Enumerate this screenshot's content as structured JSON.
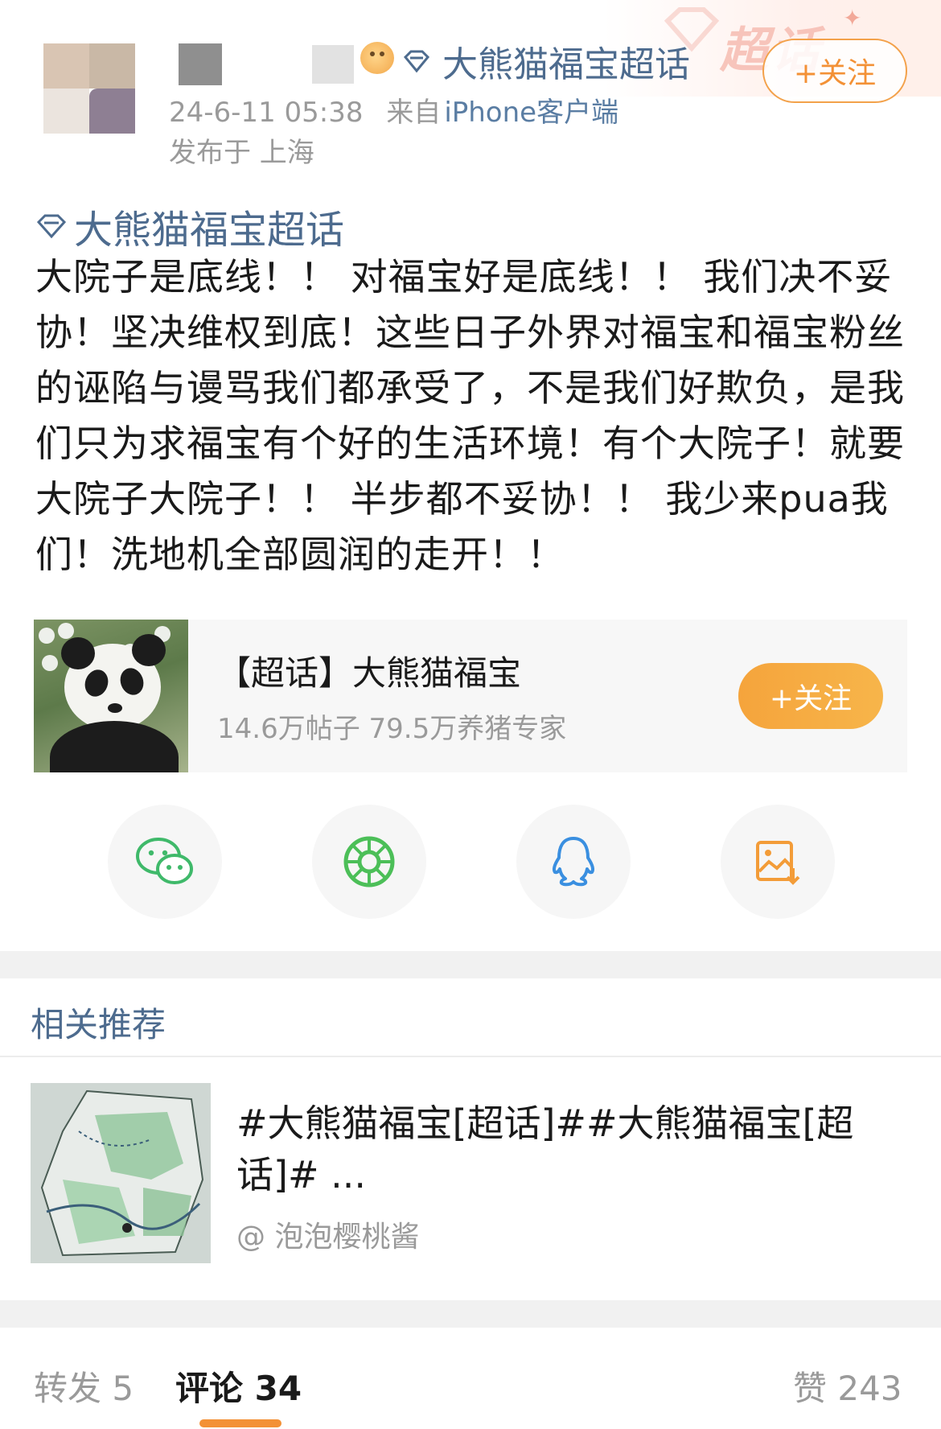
{
  "header": {
    "deco_text": "超话",
    "inline_topic": "大熊猫福宝超话",
    "timestamp": "24-6-11 05:38",
    "source_prefix": "来自",
    "source": "iPhone客户端",
    "location": "发布于 上海",
    "follow_label": "+关注"
  },
  "post": {
    "topic_tag": "大熊猫福宝超话",
    "text": "大院子是底线！！ 对福宝好是底线！！ 我们决不妥协！坚决维权到底！这些日子外界对福宝和福宝粉丝的诬陷与谩骂我们都承受了，不是我们好欺负，是我们只为求福宝有个好的生活环境！有个大院子！就要大院子大院子！！ 半步都不妥协！！ 我少来pua我们！洗地机全部圆润的走开！！"
  },
  "topic_card": {
    "name": "【超话】大熊猫福宝",
    "stats": "14.6万帖子 79.5万养猪专家",
    "follow_label": "+关注"
  },
  "share": {
    "icons": [
      "wechat-icon",
      "moments-icon",
      "qq-icon",
      "save-image-icon"
    ]
  },
  "related": {
    "title": "相关推荐",
    "item_text": "#大熊猫福宝[超话]##大熊猫福宝[超话]# ...",
    "item_author": "@ 泡泡樱桃酱"
  },
  "tabs": {
    "repost": "转发 5",
    "comment": "评论 34",
    "like": "赞 243"
  },
  "colors": {
    "link_blue": "#4d6b8e",
    "accent_orange": "#f39136",
    "gray_text": "#9a9a9a"
  }
}
